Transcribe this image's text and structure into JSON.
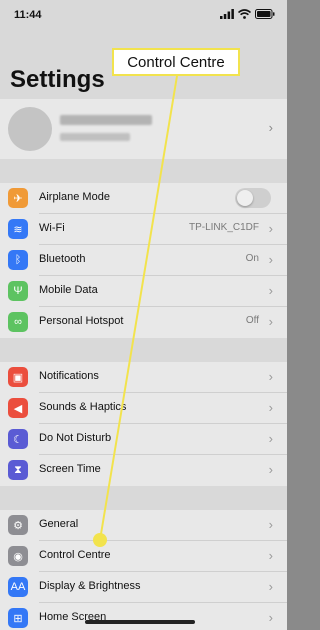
{
  "status_bar": {
    "time": "11:44"
  },
  "title": "Settings",
  "colors": {
    "callout_accent": "#f2e34d"
  },
  "groups": [
    {
      "items": [
        {
          "label": "Airplane Mode",
          "icon": "airplane-icon",
          "icon_color": "#f09a37",
          "glyph": "✈",
          "toggle": true
        },
        {
          "label": "Wi-Fi",
          "icon": "wifi-icon",
          "icon_color": "#3478f6",
          "glyph": "≋",
          "value": "TP-LINK_C1DF"
        },
        {
          "label": "Bluetooth",
          "icon": "bluetooth-icon",
          "icon_color": "#3478f6",
          "glyph": "ᛒ",
          "value": "On"
        },
        {
          "label": "Mobile Data",
          "icon": "antenna-icon",
          "icon_color": "#5dc361",
          "glyph": "Ψ"
        },
        {
          "label": "Personal Hotspot",
          "icon": "hotspot-icon",
          "icon_color": "#5dc361",
          "glyph": "∞",
          "value": "Off"
        }
      ]
    },
    {
      "items": [
        {
          "label": "Notifications",
          "icon": "notifications-icon",
          "icon_color": "#eb4e3d",
          "glyph": "▣"
        },
        {
          "label": "Sounds & Haptics",
          "icon": "speaker-icon",
          "icon_color": "#eb4e3d",
          "glyph": "◀"
        },
        {
          "label": "Do Not Disturb",
          "icon": "moon-icon",
          "icon_color": "#5a5bd4",
          "glyph": "☾"
        },
        {
          "label": "Screen Time",
          "icon": "hourglass-icon",
          "icon_color": "#5a5bd4",
          "glyph": "⧗"
        }
      ]
    },
    {
      "items": [
        {
          "label": "General",
          "icon": "gear-icon",
          "icon_color": "#8e8e93",
          "glyph": "⚙"
        },
        {
          "label": "Control Centre",
          "icon": "control-centre-icon",
          "icon_color": "#8e8e93",
          "glyph": "◉"
        },
        {
          "label": "Display & Brightness",
          "icon": "display-icon",
          "icon_color": "#3478f6",
          "glyph": "AA"
        },
        {
          "label": "Home Screen",
          "icon": "home-screen-icon",
          "icon_color": "#3478f6",
          "glyph": "⊞"
        }
      ]
    }
  ],
  "callout": {
    "text": "Control Centre"
  }
}
